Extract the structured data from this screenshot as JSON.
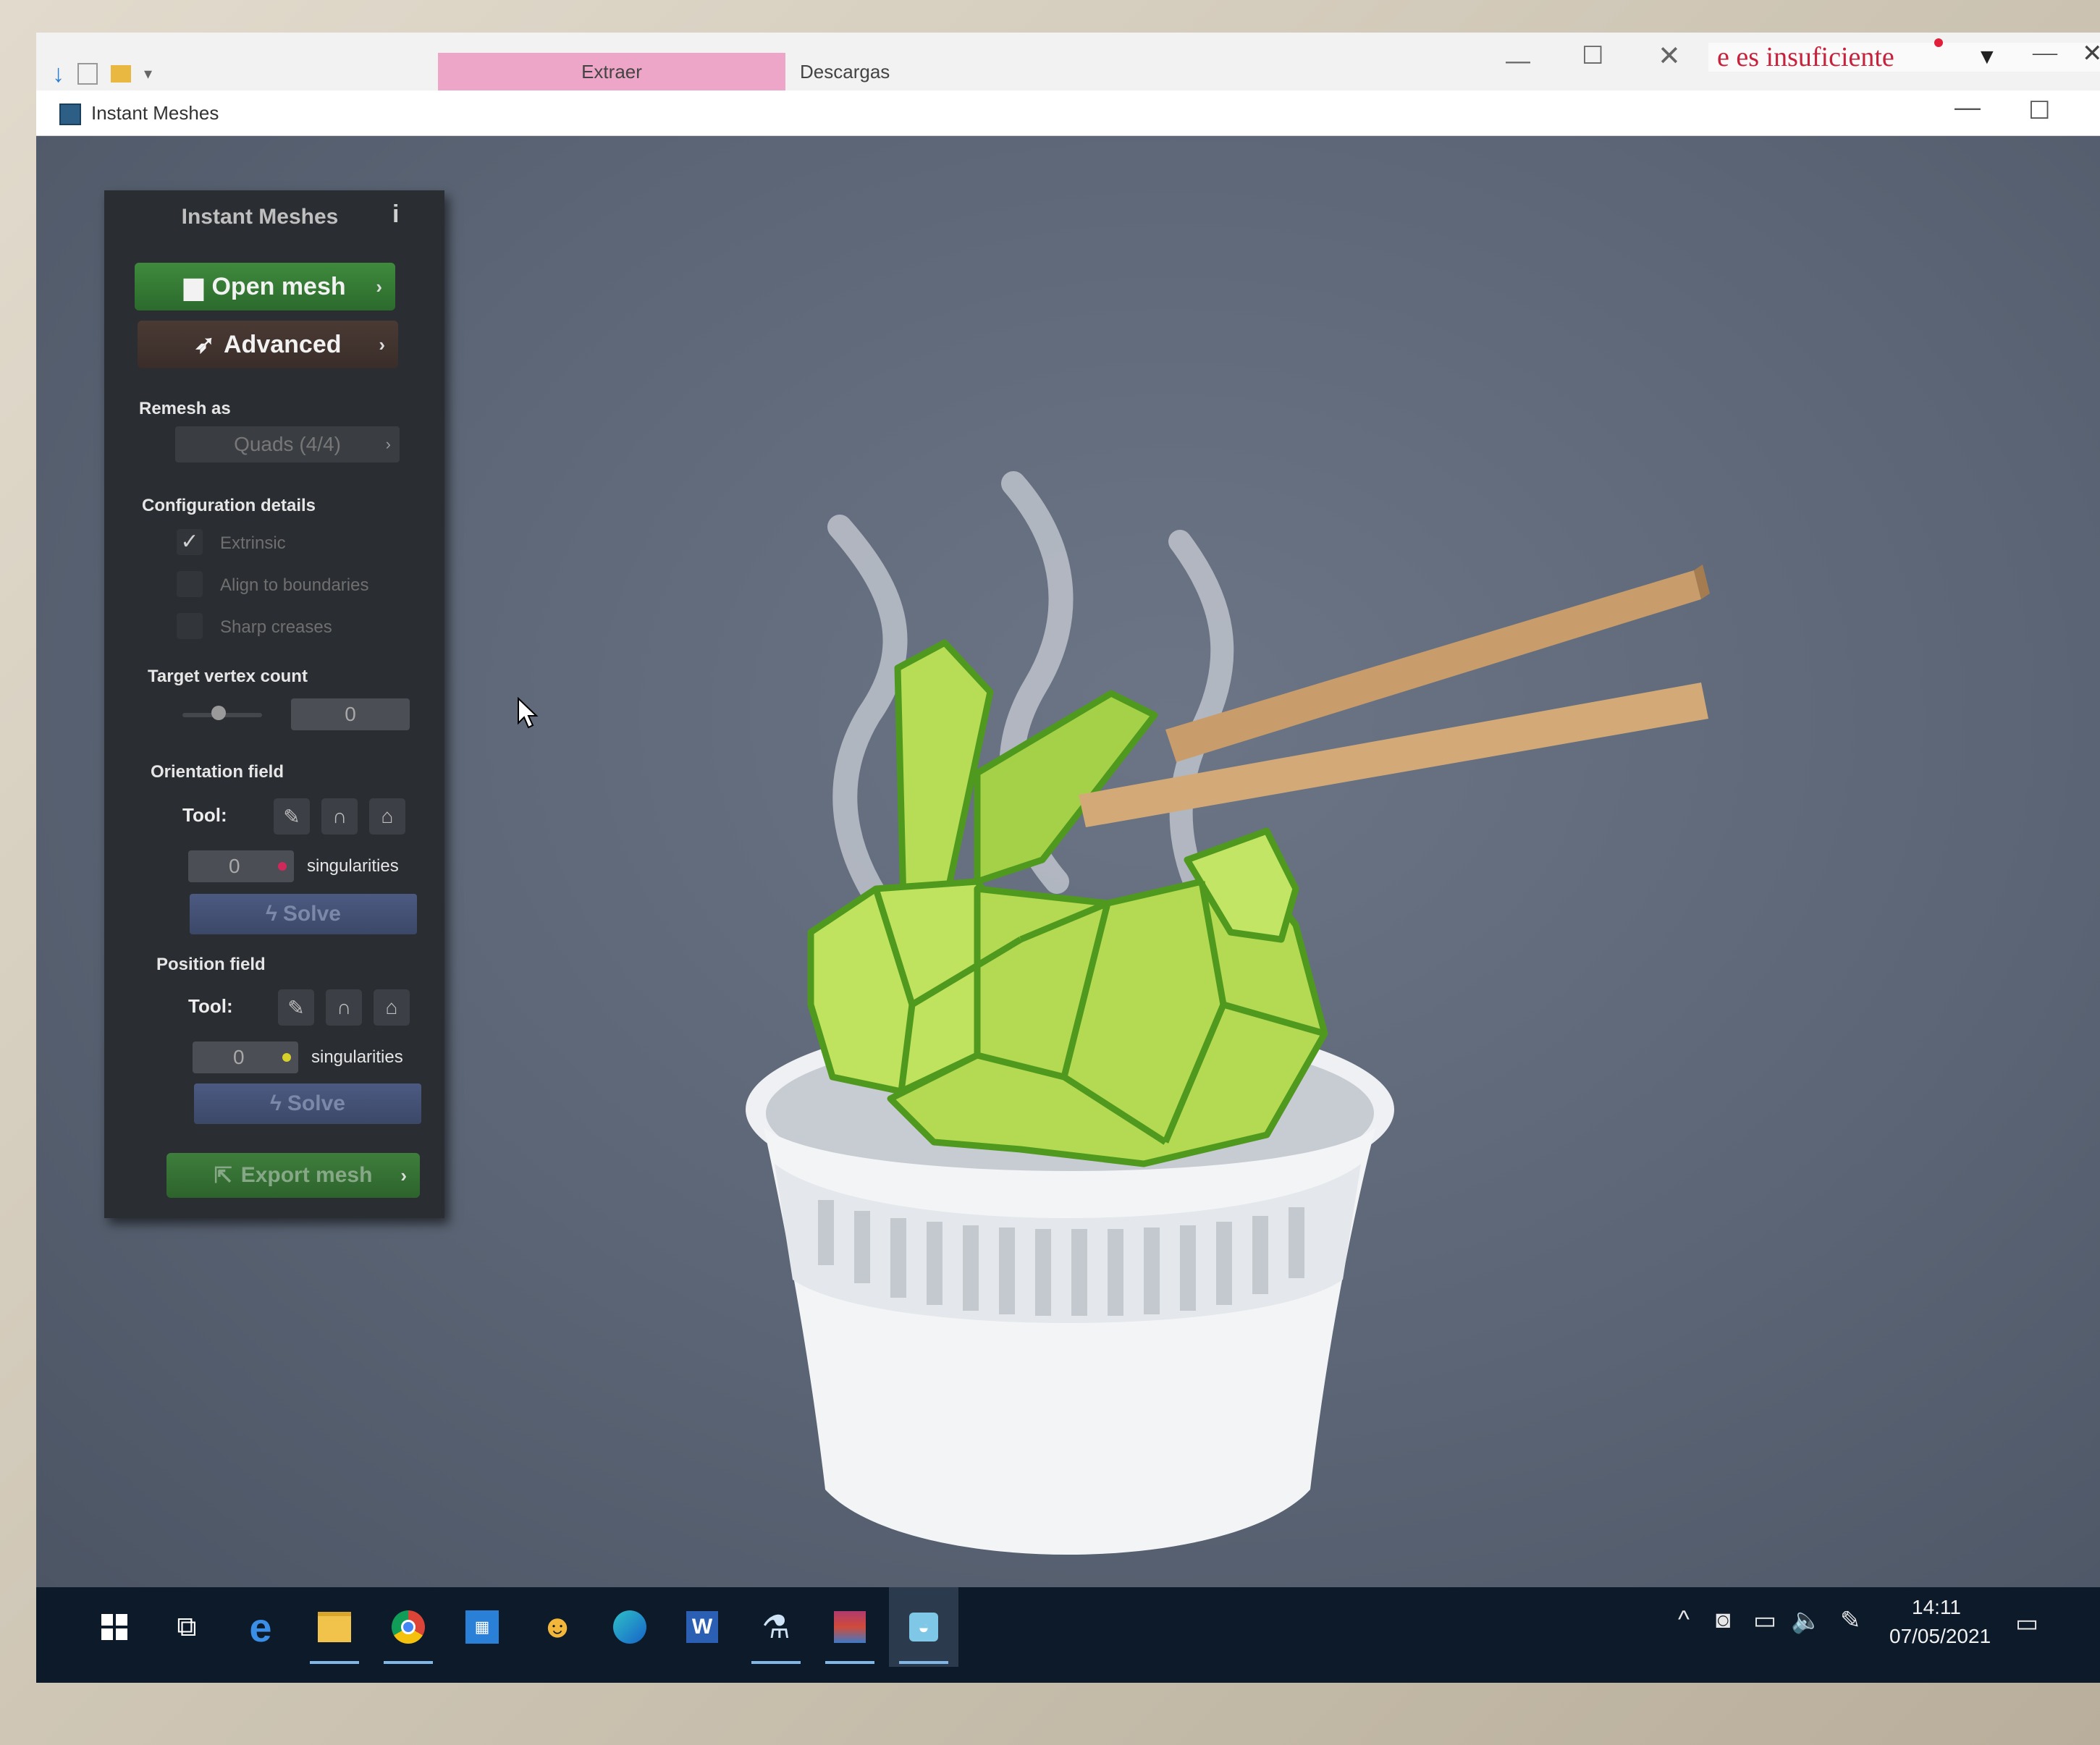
{
  "explorer": {
    "tab_extraer": "Extraer",
    "tab_descargas": "Descargas",
    "notice_text": "e es insuficiente"
  },
  "app": {
    "title": "Instant Meshes"
  },
  "panel": {
    "title": "Instant Meshes",
    "info_label": "i",
    "open_mesh": "Open mesh",
    "advanced": "Advanced",
    "remesh_as_label": "Remesh as",
    "remesh_as_value": "Quads (4/4)",
    "config_label": "Configuration details",
    "check_extrinsic": "Extrinsic",
    "check_align": "Align to boundaries",
    "check_sharp": "Sharp creases",
    "target_label": "Target vertex count",
    "target_value": "0",
    "orientation_label": "Orientation field",
    "tool_label": "Tool:",
    "orientation_singularities": "0",
    "singularities_label": "singularities",
    "solve_label": "Solve",
    "position_label": "Position field",
    "position_singularities": "0",
    "export_mesh": "Export mesh"
  },
  "taskbar": {
    "time": "14:11",
    "date": "07/05/2021"
  },
  "colors": {
    "panel_bg": "#2a2d32",
    "open_green": "#3f8a3d",
    "bunny_green": "#b6dd55",
    "bunny_edge": "#4f9a1e",
    "chopstick": "#c89d6b"
  }
}
